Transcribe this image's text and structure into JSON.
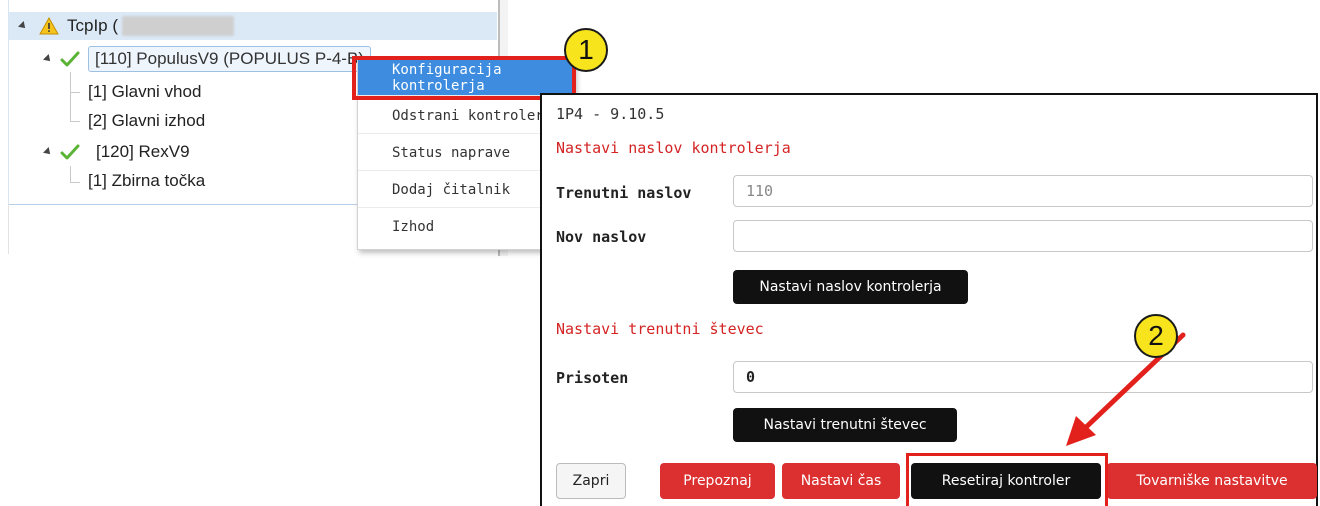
{
  "tree": {
    "root_label": "TcpIp (",
    "controller_1": "[110] PopulusV9 (POPULUS P-4-B)",
    "child_1": "[1] Glavni vhod",
    "child_2": "[2] Glavni izhod",
    "controller_2": "[120] RexV9",
    "child_3": "[1] Zbirna točka"
  },
  "context_menu": {
    "items": [
      "Konfiguracija kontrolerja",
      "Odstrani kontroler",
      "Status naprave",
      "Dodaj čitalnik",
      "Izhod"
    ],
    "active_index": 0
  },
  "badges": {
    "first": "1",
    "second": "2"
  },
  "dialog": {
    "title": "1P4 - 9.10.5",
    "section_address": "Nastavi naslov kontrolerja",
    "current_address_label": "Trenutni naslov",
    "current_address_value": "110",
    "new_address_label": "Nov naslov",
    "new_address_value": "",
    "set_address_button": "Nastavi naslov kontrolerja",
    "section_counter": "Nastavi trenutni števec",
    "present_label": "Prisoten",
    "present_value": "0",
    "set_counter_button": "Nastavi trenutni števec",
    "footer": {
      "close": "Zapri",
      "identify": "Prepoznaj",
      "set_time": "Nastavi čas",
      "reset": "Resetiraj kontroler",
      "factory": "Tovarniške nastavitve"
    }
  },
  "colors": {
    "accent_red": "#dc2f2f",
    "highlight_red": "#e3211c",
    "badge_yellow": "#f7e41c",
    "menu_active": "#3d8ce0",
    "tree_selected": "#dbe9f7"
  }
}
